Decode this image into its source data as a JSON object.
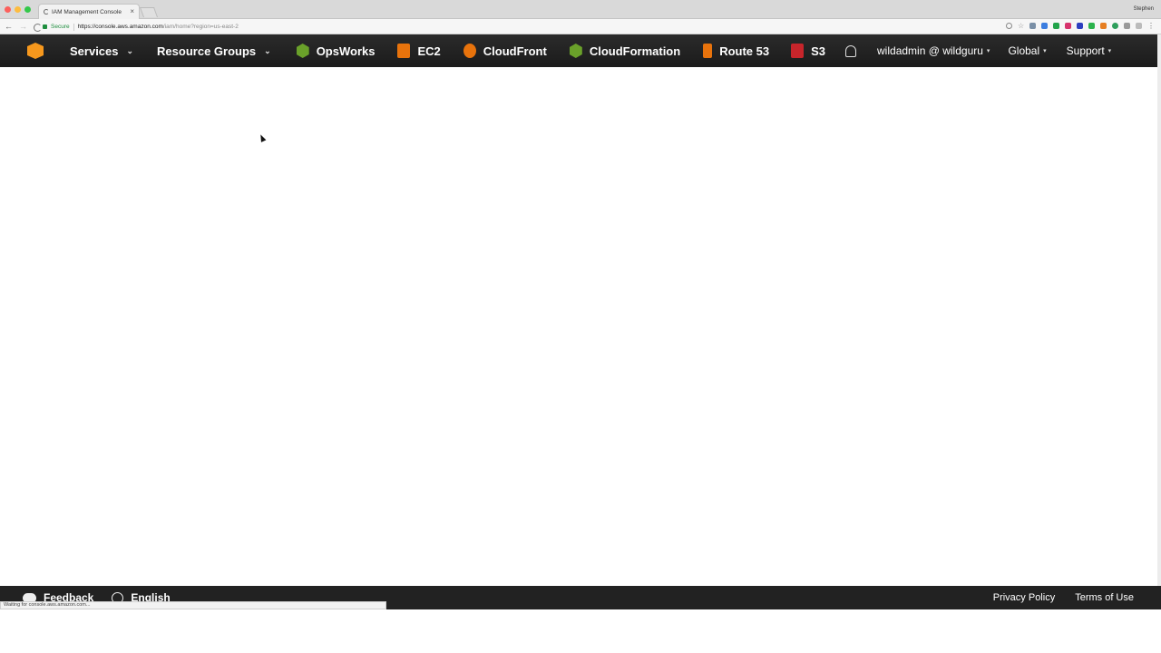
{
  "browser": {
    "tab_title": "IAM Management Console",
    "tab_close": "×",
    "profile_name": "Stephen",
    "secure_label": "Secure",
    "url_host": "https://console.aws.amazon.com",
    "url_path": "/iam/home?region=us-east-2",
    "back_glyph": "←",
    "forward_glyph": "→",
    "status_text": "Waiting for console.aws.amazon.com...",
    "traffic_light_colors": [
      "#fc605c",
      "#fdbc40",
      "#34c84a"
    ],
    "extension_colors": [
      "#7a8fa6",
      "#3b7de0",
      "#22a34a",
      "#d6336c",
      "#2d3fbf",
      "#2bb24c",
      "#e67e22",
      "#2e9e5b",
      "#999999",
      "#bbbbbb"
    ]
  },
  "awsnav": {
    "logo": "aws-cube-icon",
    "services_label": "Services",
    "resource_groups_label": "Resource Groups",
    "caret": "⌄",
    "small_caret": "▾",
    "shortcuts": [
      {
        "label": "OpsWorks",
        "icon": "opsworks-icon",
        "color": "#6aa12a"
      },
      {
        "label": "EC2",
        "icon": "ec2-icon",
        "color": "#e8730c"
      },
      {
        "label": "CloudFront",
        "icon": "cloudfront-icon",
        "color": "#e8730c"
      },
      {
        "label": "CloudFormation",
        "icon": "cloudformation-icon",
        "color": "#6aa12a"
      },
      {
        "label": "Route 53",
        "icon": "route53-icon",
        "color": "#e8730c"
      },
      {
        "label": "S3",
        "icon": "s3-icon",
        "color": "#c7252b"
      }
    ],
    "account_label": "wildadmin @ wildguru",
    "region_label": "Global",
    "support_label": "Support",
    "accent_color": "#f7981d"
  },
  "footer": {
    "feedback_label": "Feedback",
    "language_label": "English",
    "privacy_label": "Privacy Policy",
    "terms_label": "Terms of Use"
  }
}
